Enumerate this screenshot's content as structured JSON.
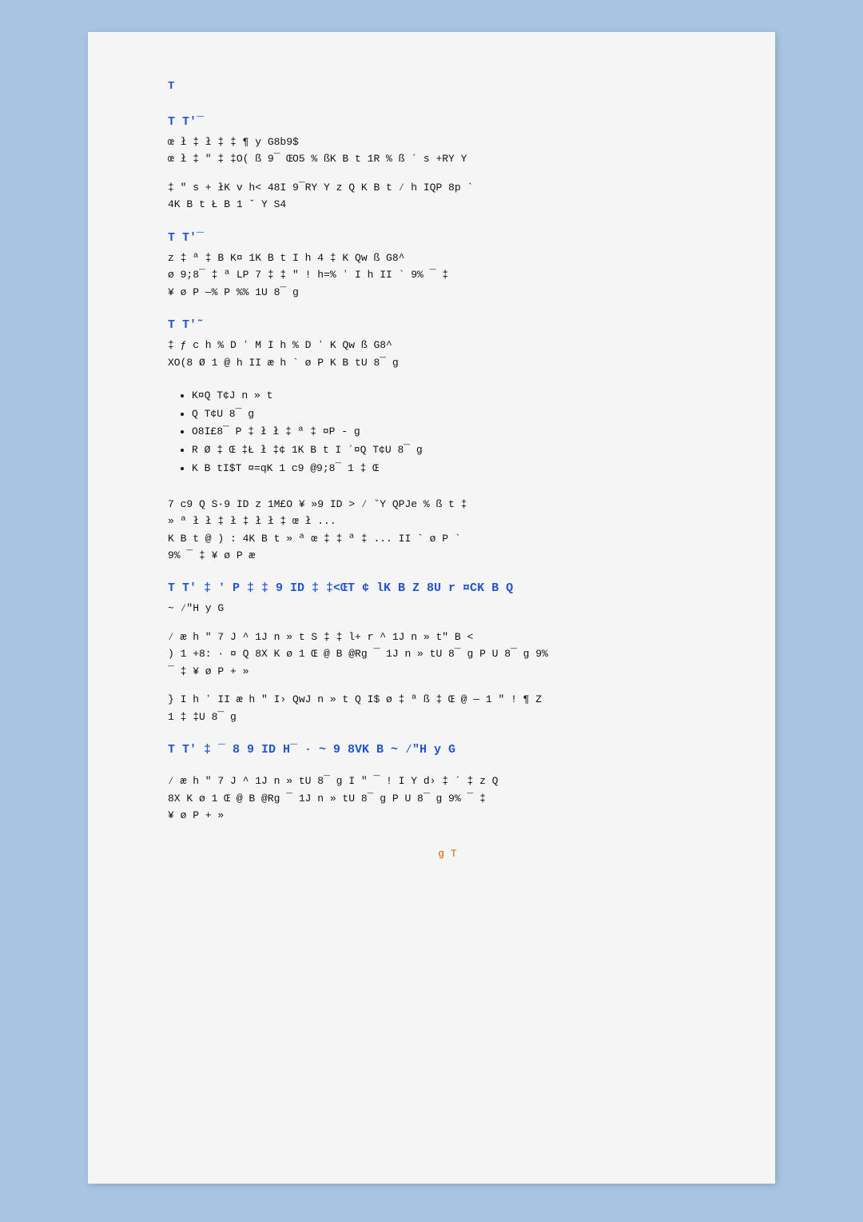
{
  "page": {
    "top_label": "T",
    "sections": [
      {
        "id": "s1",
        "title": "T T'¯",
        "lines": [
          "          œ ł ‡ ł ‡             ‡ ¶ y G8b9$",
          "          œ ł ‡ \" ‡   ‡O( ß  9¯ ŒO5 % ßK  B t 1R   % ß ´ s +RY Y",
          "",
          "     ‡ \" s +  łK  v    h<  48I  9¯RY Y z  Q   K  B t ⁄ h IQP     8p `",
          " 4K  B t   Ł B 1 ˇ Y  S4"
        ]
      },
      {
        "id": "s2",
        "title": "T T'¯",
        "lines": [
          " z  ‡ ª   ‡ B  K¤  1K  B t    I h   4 ‡               K Qw ß G8^",
          "     ø  9;8¯ ‡ ª   LP 7 ‡              ‡ \" ! h=% ʼ      I h  II `  9% ¯ ‡",
          "          ¥  ø   P  —%    P  %% 1U 8¯  g"
        ]
      },
      {
        "id": "s3",
        "title": "T T'˜",
        "lines": [
          "          ‡ ƒ c h % D ʼ    M   I h % D ʼ   K Qw ß G8^",
          "      XO(8  Ø 1 @ h    II æ h `   ø   P K  B tU 8¯  g"
        ]
      },
      {
        "id": "s3_bullets",
        "title": null,
        "bullets": [
          "K¤Q T¢J n  » t",
          " Q T¢U 8¯  g",
          "  O8I£8¯   P ‡  ł    ł ‡ ª     ‡ ¤P  -  g",
          "R  Ø ‡ Œ      ‡Ł     ł ‡¢    1K  B t I ´¤Q T¢U 8¯  g",
          " K  B tI$T  ¤=qK  1 c9  @9;8¯ 1 ‡ Œ"
        ]
      },
      {
        "id": "s4",
        "title": null,
        "lines": [
          "  7    c9  Q  S·9 ID   z 1M£O    ¥   »9 ID > ⁄   ˇY   QPJe % ß t ‡",
          "» ª    ł    ł   ‡      ł  ‡  ł   ł ‡     œ ł  ...",
          "   K  B t  @  )  :  4K  B t  » ª   œ ‡    ‡ ª   ‡          ...  II `   ø  P    `",
          "9% ¯ ‡                 ¥  ø  P   æ"
        ]
      },
      {
        "id": "s5",
        "title": "T T' ‡ ʼ",
        "title_extra": " P ‡              ‡  9 ID ‡              ‡<ŒT   ¢ lK  B Z  8U r ¤CK  B  Q",
        "lines": [
          "~   ⁄\"H  y G",
          "",
          "     ⁄ æ h \" 7 J ^ 1J  n   » t S ‡               ‡ l+ r    ^ 1J  n  » t\" B  <",
          ") 1 +8: · ¤  Q 8X  K   ø 1 Œ @ B @Rg ¯   1J  n   » tU 8¯  g   P U 8¯  g  9%",
          "¯ ‡                  ¥  ø  P  + »",
          "",
          "  } I h ʼ   II æ h \" I›  QwJ  n   » t  Q I$ ø ‡ ª ß       ‡ Œ @ — 1   \" ! ¶ Z",
          " 1 ‡                 ‡U 8¯  g"
        ]
      },
      {
        "id": "s6",
        "title": "T T' ‡ ¯",
        "title_extra": "  8 9 ID  H¯ · ~   9   8VK  B   ~   ⁄\"H  y G",
        "lines": [
          "",
          "     ⁄ æ h \" 7 J ^ 1J  n    » tU 8¯  g I \" ¯   !  I Y d›  ‡    ´    ‡ z   Q",
          "8X  K   ø 1 Œ @ B @Rg ¯   1J  n   » tU 8¯  g   P U 8¯  g  9% ¯ ‡",
          "¥  ø   P  + »"
        ]
      }
    ],
    "footer_label": "g  T"
  }
}
